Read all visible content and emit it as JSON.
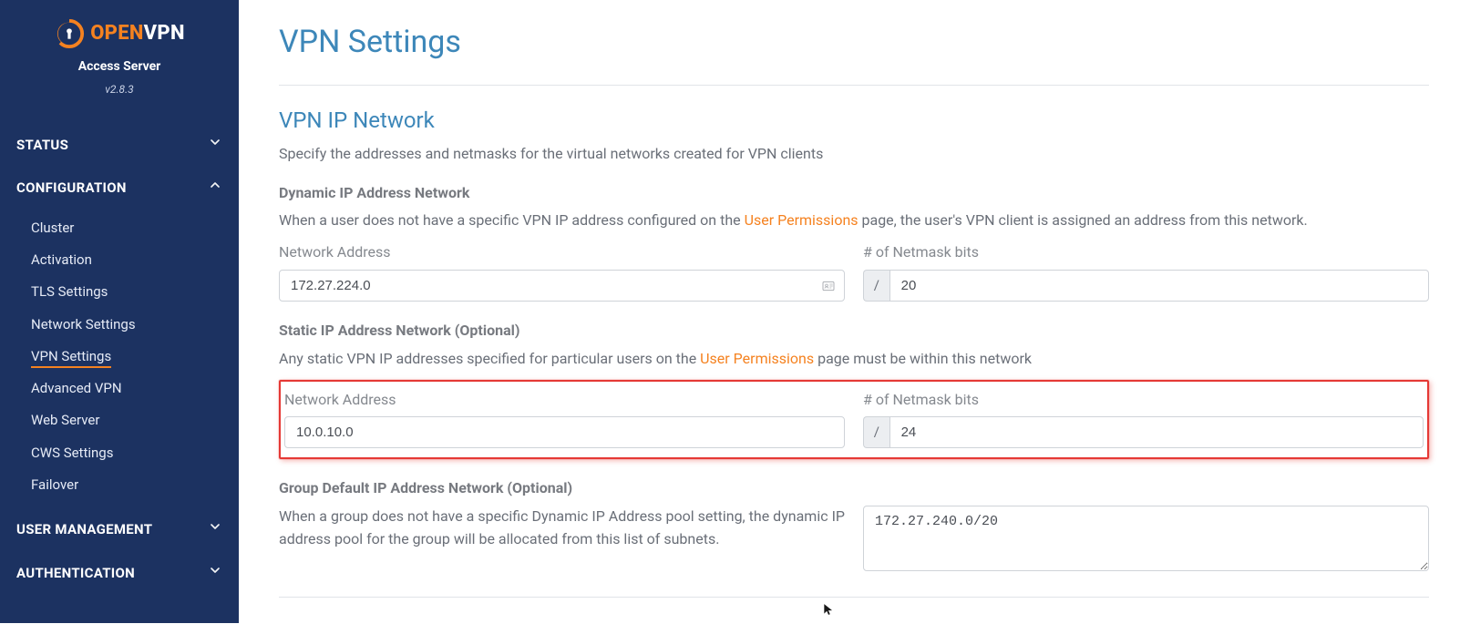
{
  "brand": {
    "word_open": "OPEN",
    "word_vpn": "VPN",
    "subtitle": "Access Server",
    "version": "v2.8.3"
  },
  "sidebar": {
    "sections": [
      {
        "label": "STATUS",
        "expanded": false,
        "items": []
      },
      {
        "label": "CONFIGURATION",
        "expanded": true,
        "items": [
          {
            "label": "Cluster"
          },
          {
            "label": "Activation"
          },
          {
            "label": "TLS Settings"
          },
          {
            "label": "Network Settings"
          },
          {
            "label": "VPN Settings",
            "active": true
          },
          {
            "label": "Advanced VPN"
          },
          {
            "label": "Web Server"
          },
          {
            "label": "CWS Settings"
          },
          {
            "label": "Failover"
          }
        ]
      },
      {
        "label": "USER  MANAGEMENT",
        "expanded": false,
        "items": []
      },
      {
        "label": "AUTHENTICATION",
        "expanded": false,
        "items": []
      }
    ]
  },
  "page": {
    "title": "VPN Settings",
    "section_title": "VPN IP Network",
    "section_desc": "Specify the addresses and netmasks for the virtual networks created for VPN clients"
  },
  "labels": {
    "network_address": "Network Address",
    "netmask_bits": "# of Netmask bits",
    "mask_prefix": "/"
  },
  "dynamic": {
    "title": "Dynamic IP Address Network",
    "desc_pre": "When a user does not have a specific VPN IP address configured on the ",
    "link": "User Permissions",
    "desc_post": " page, the user's VPN client is assigned an address from this network.",
    "network_address": "172.27.224.0",
    "netmask_bits": "20"
  },
  "static_net": {
    "title": "Static IP Address Network (Optional)",
    "desc_pre": "Any static VPN IP addresses specified for particular users on the ",
    "link": "User Permissions",
    "desc_post": " page must be within this network",
    "network_address": "10.0.10.0",
    "netmask_bits": "24"
  },
  "group_default": {
    "title": "Group Default IP Address Network (Optional)",
    "desc": "When a group does not have a specific Dynamic IP Address pool setting, the dynamic IP address pool for the group will be allocated from this list of subnets.",
    "value": "172.27.240.0/20"
  },
  "colors": {
    "brand_orange": "#f58220",
    "sidebar_bg": "#1c3261",
    "heading_blue": "#3d87b9"
  }
}
